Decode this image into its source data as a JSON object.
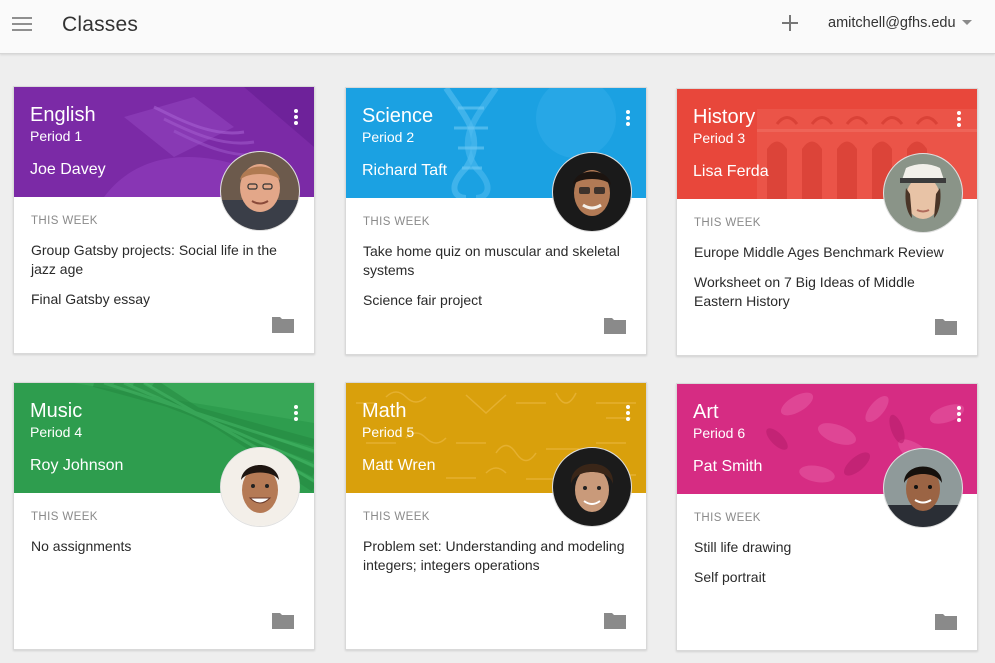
{
  "app": {
    "title": "Classes",
    "account": "amitchell@gfhs.edu"
  },
  "icons": {
    "menu": "menu-icon",
    "add": "plus-icon",
    "account_caret": "caret-down-icon",
    "more": "more-vert-icon",
    "folder": "folder-icon"
  },
  "colors": {
    "english": "#7b2aa6",
    "science": "#1ba1e2",
    "history": "#e8473b",
    "music": "#2e9d4e",
    "math": "#d9a00c",
    "art": "#d62c83"
  },
  "classes": [
    {
      "name": "English",
      "period": "Period 1",
      "teacher": "Joe Davey",
      "week_label": "THIS WEEK",
      "assignments": [
        "Group Gatsby projects: Social life in the jazz age",
        "Final Gatsby essay"
      ]
    },
    {
      "name": "Science",
      "period": "Period 2",
      "teacher": "Richard Taft",
      "week_label": "THIS WEEK",
      "assignments": [
        "Take home quiz on muscular and skeletal systems",
        "Science fair project"
      ]
    },
    {
      "name": "History",
      "period": "Period 3",
      "teacher": "Lisa Ferda",
      "week_label": "THIS WEEK",
      "assignments": [
        "Europe Middle Ages Benchmark Review",
        "Worksheet on 7 Big Ideas of Middle Eastern History"
      ]
    },
    {
      "name": "Music",
      "period": "Period 4",
      "teacher": "Roy Johnson",
      "week_label": "THIS WEEK",
      "assignments": [
        "No assignments"
      ]
    },
    {
      "name": "Math",
      "period": "Period 5",
      "teacher": "Matt Wren",
      "week_label": "THIS WEEK",
      "assignments": [
        "Problem set: Understanding and modeling integers; integers operations"
      ]
    },
    {
      "name": "Art",
      "period": "Period 6",
      "teacher": "Pat Smith",
      "week_label": "THIS WEEK",
      "assignments": [
        "Still life drawing",
        "Self portrait"
      ]
    }
  ]
}
